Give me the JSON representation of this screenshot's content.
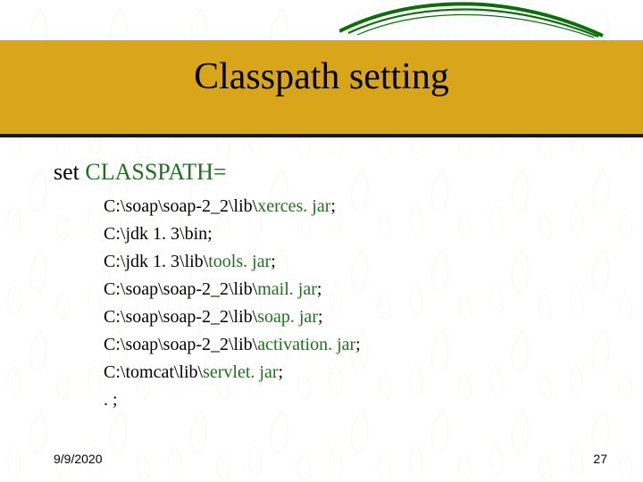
{
  "title": "Classpath setting",
  "command": {
    "label": "set ",
    "var": "CLASSPATH="
  },
  "paths": [
    {
      "black": "C:\\soap\\soap-2_2\\lib\\",
      "green": "xerces. jar",
      "suffix": ";"
    },
    {
      "black": "C:\\jdk 1. 3\\bin;",
      "green": "",
      "suffix": ""
    },
    {
      "black": "C:\\jdk 1. 3\\lib\\",
      "green": "tools. jar",
      "suffix": ";"
    },
    {
      "black": "C:\\soap\\soap-2_2\\lib\\",
      "green": "mail. jar",
      "suffix": ";"
    },
    {
      "black": "C:\\soap\\soap-2_2\\lib\\",
      "green": "soap. jar",
      "suffix": ";"
    },
    {
      "black": "C:\\soap\\soap-2_2\\lib\\",
      "green": "activation. jar",
      "suffix": ";"
    },
    {
      "black": "C:\\tomcat\\lib\\",
      "green": "servlet. jar",
      "suffix": ";"
    },
    {
      "black": ". ;",
      "green": "",
      "suffix": ""
    }
  ],
  "footer": {
    "date": "9/9/2020",
    "page": "27"
  },
  "colors": {
    "brand_gold": "#d9a51a",
    "text_green": "#1f6f1f",
    "swoosh_green": "#0b6e0b"
  }
}
